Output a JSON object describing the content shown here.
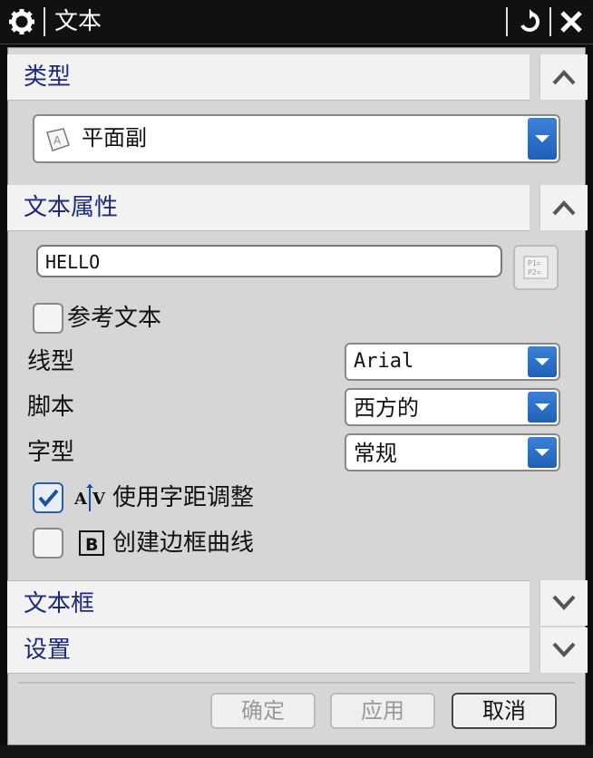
{
  "window": {
    "title": "文本"
  },
  "sections": {
    "type": {
      "label": "类型",
      "combo_value": "平面副"
    },
    "properties": {
      "label": "文本属性",
      "text_value": "HELLO",
      "reference_text_label": "参考文本",
      "font_label": "线型",
      "font_value": "Arial",
      "script_label": "脚本",
      "script_value": "西方的",
      "style_label": "字型",
      "style_value": "常规",
      "kerning_label": "使用字距调整",
      "border_label": "创建边框曲线",
      "kerning_checked": true,
      "border_checked": false,
      "reference_checked": false
    },
    "textbox": {
      "label": "文本框"
    },
    "settings": {
      "label": "设置"
    }
  },
  "buttons": {
    "ok": "确定",
    "apply": "应用",
    "cancel": "取消"
  },
  "icons": [
    "gear-icon",
    "reset-icon",
    "close-icon",
    "chevron-up-icon",
    "chevron-down-icon",
    "dropdown-arrow-icon",
    "symbol-icon",
    "kerning-icon",
    "border-b-icon",
    "text-type-icon"
  ]
}
